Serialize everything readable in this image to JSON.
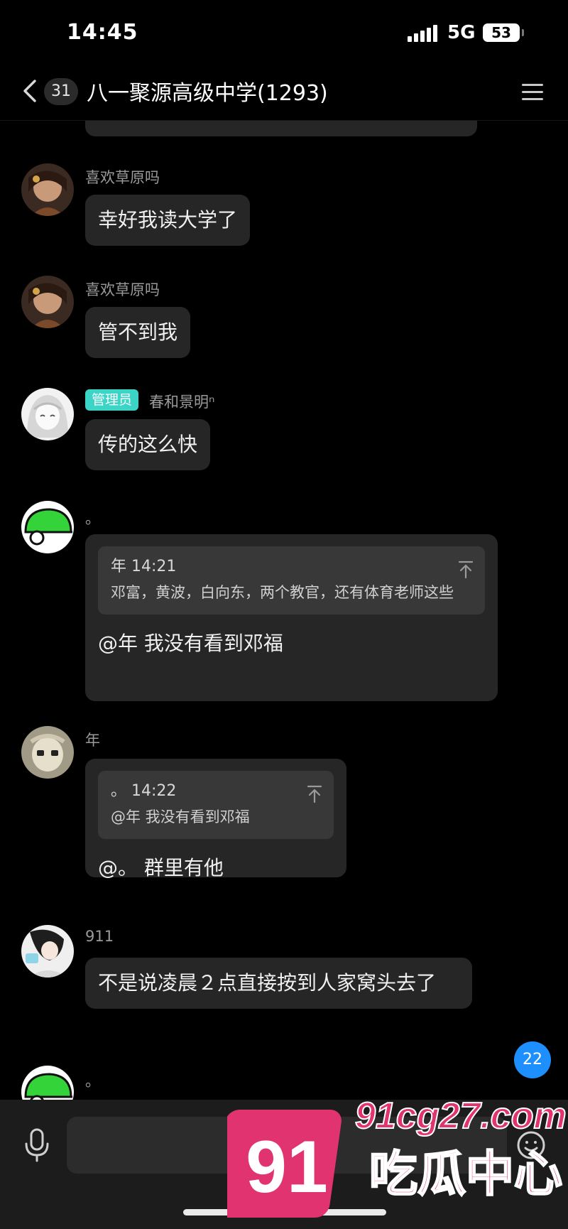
{
  "status": {
    "time": "14:45",
    "network": "5G",
    "battery": "53"
  },
  "header": {
    "unread_count": "31",
    "title": "八一聚源高级中学(1293)"
  },
  "messages": [
    {
      "sender": "喜欢草原吗",
      "text": "幸好我读大学了"
    },
    {
      "sender": "喜欢草原吗",
      "text": "管不到我"
    },
    {
      "badge": "管理员",
      "sender": "春和景明ⁿ",
      "text": "传的这么快"
    },
    {
      "sender": "。",
      "quote": {
        "author": "年",
        "time": "14:21",
        "text": "邓富，黄波，白向东，两个教官，还有体育老师这些"
      },
      "text": "@年 我没有看到邓福"
    },
    {
      "sender": "年",
      "quote": {
        "author": "。",
        "time": "14:22",
        "text": "@年 我没有看到邓福"
      },
      "text": "@。 群里有他"
    },
    {
      "sender": "911",
      "text": "不是说凌晨２点直接按到人家窝头去了"
    },
    {
      "sender": "。"
    }
  ],
  "unread_fab": "22",
  "watermark": {
    "number": "91",
    "url": "91cg27.com",
    "name": "吃瓜中心"
  },
  "colors": {
    "background": "#000000",
    "bubble": "#262626",
    "quote": "#383838",
    "badge": "#3ad5c7",
    "accent": "#1e8fff",
    "watermark": "#e0336f"
  },
  "icons": [
    "back-arrow-icon",
    "menu-icon",
    "pin-top-icon",
    "microphone-icon",
    "emoji-icon"
  ]
}
